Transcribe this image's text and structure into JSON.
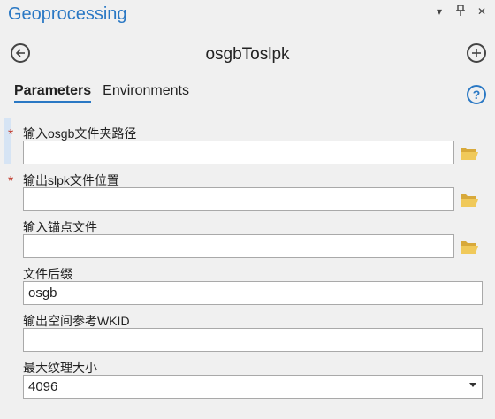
{
  "pane": {
    "title": "Geoprocessing",
    "controls": {
      "menu": "▾",
      "pin": "📌",
      "close": "✕"
    }
  },
  "toolbar": {
    "back_icon": "back-arrow-circle-icon",
    "tool_name": "osgbToslpk",
    "add_icon": "plus-circle-icon"
  },
  "tabs": [
    {
      "label": "Parameters",
      "active": true
    },
    {
      "label": "Environments",
      "active": false
    }
  ],
  "help_icon": "question-circle-icon",
  "params": [
    {
      "label": "输入osgb文件夹路径",
      "required": true,
      "value": "",
      "placeholder": "",
      "browse": true
    },
    {
      "label": "输出slpk文件位置",
      "required": true,
      "value": "",
      "placeholder": "",
      "browse": true
    },
    {
      "label": "输入锚点文件",
      "required": false,
      "value": "",
      "placeholder": "",
      "browse": true
    },
    {
      "label": "文件后缀",
      "required": false,
      "value": "osgb",
      "browse": false
    },
    {
      "label": "输出空间参考WKID",
      "required": false,
      "value": "",
      "browse": false
    },
    {
      "label": "最大纹理大小",
      "required": false,
      "value": "4096",
      "browse": false,
      "dropdown": true
    }
  ],
  "required_marker": "*",
  "colors": {
    "accent": "#2a78c4",
    "required": "#c0392b",
    "folder": "#e8c35a"
  }
}
